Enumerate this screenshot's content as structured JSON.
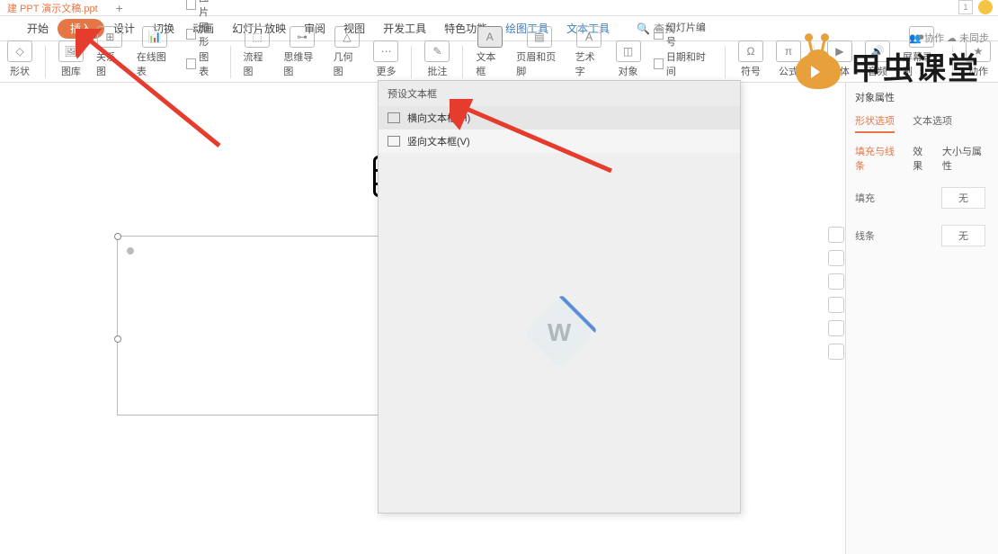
{
  "titlebar": {
    "document": "建 PPT 演示文稿.ppt",
    "add": "+",
    "sys_btn": "1"
  },
  "tabs": {
    "start": "开始",
    "insert": "插入",
    "design": "设计",
    "transition": "切换",
    "animation": "动画",
    "slideshow": "幻灯片放映",
    "review": "审阅",
    "view": "视图",
    "dev": "开发工具",
    "special": "特色功能",
    "draw_tools": "绘图工具",
    "text_tools": "文本工具",
    "search_label": "查找"
  },
  "ribbon": {
    "shape": "形状",
    "gallery": "图库",
    "relation": "关系图",
    "online_chart": "在线图表",
    "mini_img": "图片",
    "mini_shape": "图形",
    "mini_chart": "图表",
    "flowchart": "流程图",
    "mindmap": "思维导图",
    "geometry": "几何图",
    "more": "更多",
    "comment": "批注",
    "textbox": "文本框",
    "header_footer": "页眉和页脚",
    "wordart": "艺术字",
    "object": "对象",
    "mini_slide_num": "幻灯片编号",
    "mini_datetime": "日期和时间",
    "symbol": "符号",
    "equation": "公式",
    "media": "媒体",
    "audio": "音频",
    "screenrec": "屏幕录制",
    "action": "动作"
  },
  "sync": {
    "not_sync": "未同步",
    "collab": "协作"
  },
  "dropdown": {
    "header": "预设文本框",
    "item_h": "横向文本框(H)",
    "item_v": "竖向文本框(V)"
  },
  "format_panel": {
    "title": "对象属性",
    "tab_shape": "形状选项",
    "tab_text": "文本选项",
    "sub_fill": "填充与线条",
    "sub_effect": "效果",
    "sub_size": "大小与属性",
    "row_fill": "填充",
    "row_line": "线条",
    "val_none": "无"
  },
  "brand": "甲虫课堂"
}
